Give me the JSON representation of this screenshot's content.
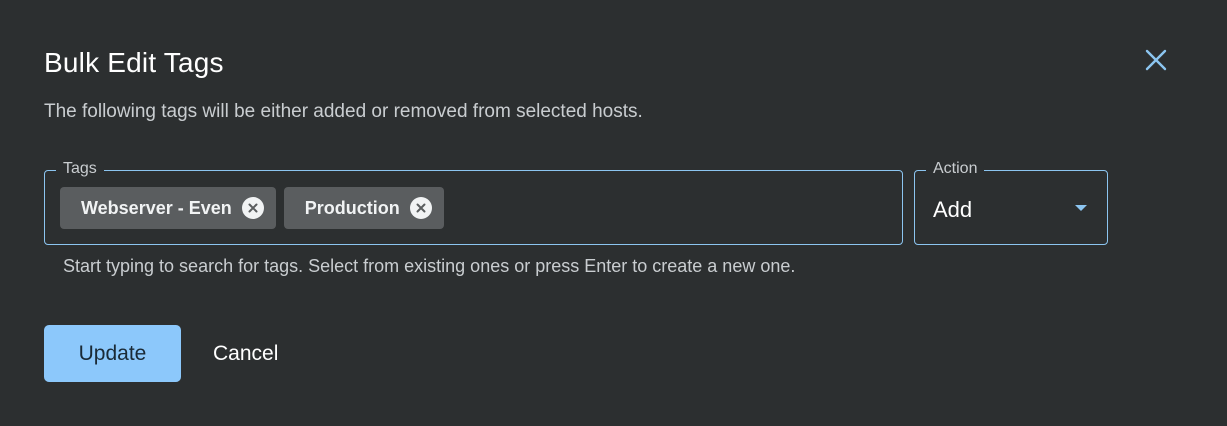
{
  "dialog": {
    "title": "Bulk Edit Tags",
    "subtitle": "The following tags will be either added or removed from selected hosts.",
    "close_icon": "close-icon"
  },
  "tags_field": {
    "label": "Tags",
    "chips": [
      {
        "label": "Webserver - Even",
        "remove_icon": "remove-circle-icon"
      },
      {
        "label": "Production",
        "remove_icon": "remove-circle-icon"
      }
    ],
    "helper_text": "Start typing to search for tags. Select from existing ones or press Enter to create a new one."
  },
  "action_field": {
    "label": "Action",
    "value": "Add",
    "arrow_icon": "caret-down-icon"
  },
  "buttons": {
    "update_label": "Update",
    "cancel_label": "Cancel"
  },
  "colors": {
    "background": "#2c2f30",
    "accent": "#8cc5f0",
    "primary_button": "#8cc8fb",
    "chip_background": "#5a5d5f"
  }
}
